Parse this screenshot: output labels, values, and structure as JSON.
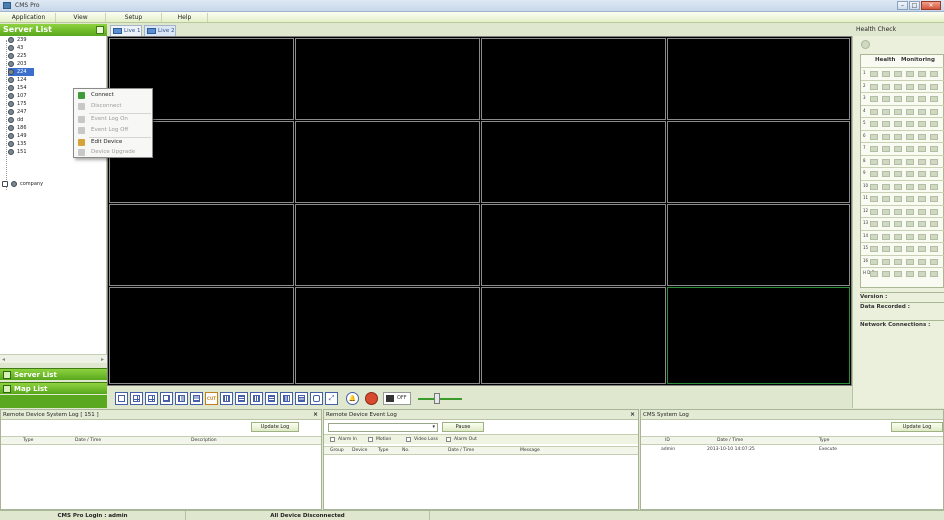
{
  "window": {
    "title": "CMS Pro"
  },
  "menu": [
    "Application",
    "View",
    "Setup",
    "Help"
  ],
  "server_list": {
    "title": "Server List",
    "items": [
      "239",
      "43",
      "225",
      "203",
      "224",
      "124",
      "154",
      "107",
      "175",
      "247",
      "dd",
      "186",
      "149",
      "135",
      "151",
      "company"
    ],
    "selected": "224"
  },
  "context_menu": {
    "items": [
      {
        "label": "Connect",
        "enabled": true,
        "icon": "connect-icon"
      },
      {
        "label": "Disconnect",
        "enabled": false,
        "icon": "disconnect-icon"
      },
      {
        "label": "Event Log On",
        "enabled": false,
        "icon": "event-log-on-icon"
      },
      {
        "label": "Event Log Off",
        "enabled": false,
        "icon": "event-log-off-icon"
      },
      {
        "label": "Edit Device",
        "enabled": true,
        "icon": "edit-device-icon"
      },
      {
        "label": "Device Upgrade",
        "enabled": false,
        "icon": "device-upgrade-icon"
      }
    ]
  },
  "tabs": [
    "Live 1",
    "Live 2"
  ],
  "nav": {
    "server_list": "Server List",
    "map_list": "Map List"
  },
  "toolbar": {
    "off_label": "OFF"
  },
  "health": {
    "title": "Health Check",
    "col_health": "Health",
    "col_monitoring": "Monitoring",
    "rows": [
      "1",
      "2",
      "3",
      "4",
      "5",
      "6",
      "7",
      "8",
      "9",
      "10",
      "11",
      "12",
      "13",
      "14",
      "15",
      "16",
      "H D D"
    ],
    "version_label": "Version :",
    "data_recorded_label": "Data Recorded :",
    "network_label": "Network Connections :"
  },
  "device_system_log": {
    "title": "Remote Device System Log  [ 151 ]",
    "button": "Update Log",
    "columns": [
      "Type",
      "Date / Time",
      "Description"
    ]
  },
  "device_event_log": {
    "title": "Remote Device Event Log",
    "button": "Pause",
    "filters": [
      "Alarm In",
      "Motion",
      "Video Loss",
      "Alarm Out"
    ],
    "columns": [
      "Group",
      "Device",
      "Type",
      "No.",
      "Date / Time",
      "Message"
    ]
  },
  "cms_system_log": {
    "title": "CMS System Log",
    "button": "Update Log",
    "columns": [
      "ID",
      "Date / Time",
      "Type"
    ],
    "rows": [
      {
        "id": "admin",
        "datetime": "2013-10-10 14:07:25",
        "type": "Execute"
      }
    ]
  },
  "status": {
    "login": "CMS Pro Login : admin",
    "devices": "All Device Disconnected"
  },
  "colors": {
    "accent_green": "#58a81c",
    "selection_blue": "#3b6fcb",
    "active_cell_border": "#2e8f3b"
  }
}
